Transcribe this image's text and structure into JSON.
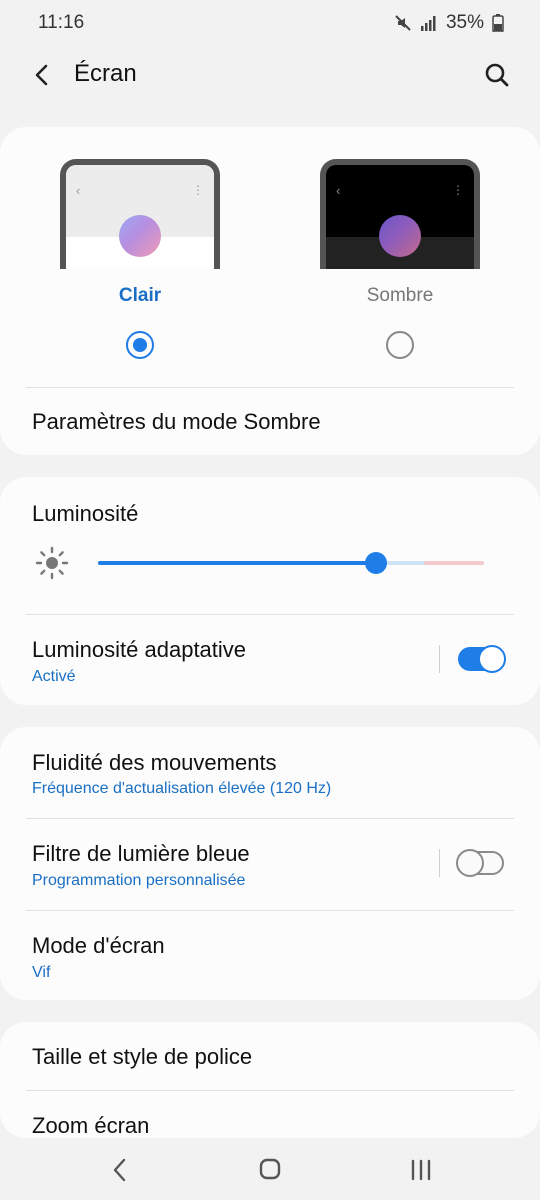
{
  "status": {
    "time": "11:16",
    "battery": "35%"
  },
  "header": {
    "title": "Écran"
  },
  "theme": {
    "light_label": "Clair",
    "dark_label": "Sombre",
    "selected": "light",
    "dark_settings_label": "Paramètres du mode Sombre"
  },
  "brightness": {
    "title": "Luminosité",
    "level": 0.72,
    "adaptive_title": "Luminosité adaptative",
    "adaptive_status": "Activé",
    "adaptive_on": true
  },
  "display": {
    "motion_title": "Fluidité des mouvements",
    "motion_sub": "Fréquence d'actualisation élevée (120 Hz)",
    "bluelight_title": "Filtre de lumière bleue",
    "bluelight_sub": "Programmation personnalisée",
    "bluelight_on": false,
    "screen_mode_title": "Mode d'écran",
    "screen_mode_sub": "Vif"
  },
  "font": {
    "font_title": "Taille et style de police",
    "zoom_title": "Zoom écran"
  },
  "colors": {
    "accent": "#1e7de6",
    "link": "#1a6fc4"
  }
}
